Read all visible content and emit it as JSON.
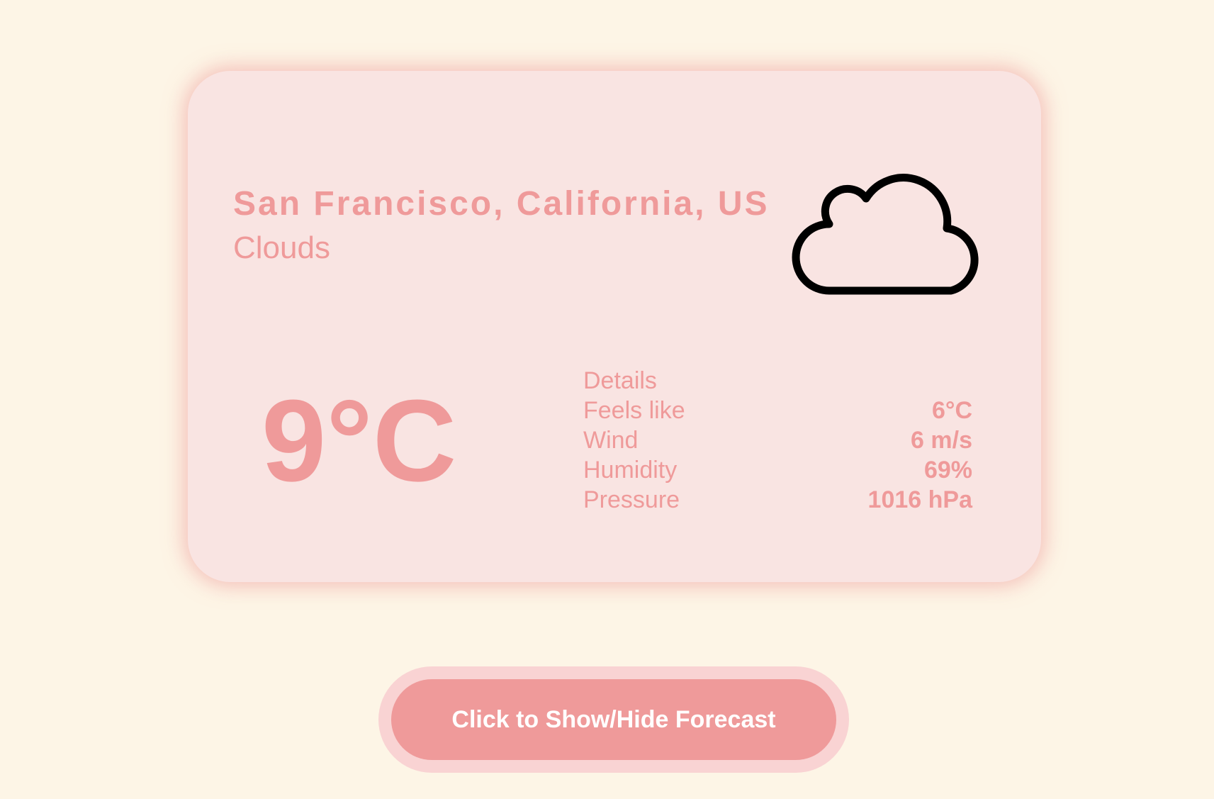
{
  "weather": {
    "location": "San Francisco, California, US",
    "condition": "Clouds",
    "temperature": "9°C",
    "icon": "cloud-icon"
  },
  "details": {
    "title": "Details",
    "rows": [
      {
        "label": "Feels like",
        "value": "6°C"
      },
      {
        "label": "Wind",
        "value": "6 m/s"
      },
      {
        "label": "Humidity",
        "value": "69%"
      },
      {
        "label": "Pressure",
        "value": "1016 hPa"
      }
    ]
  },
  "forecast_toggle": {
    "label": "Click to Show/Hide Forecast"
  },
  "colors": {
    "background": "#fdf5e6",
    "card": "#f9e4e2",
    "accent": "#ef9a9a",
    "button_ring": "#f9d3d3",
    "button_text": "#ffffff"
  }
}
